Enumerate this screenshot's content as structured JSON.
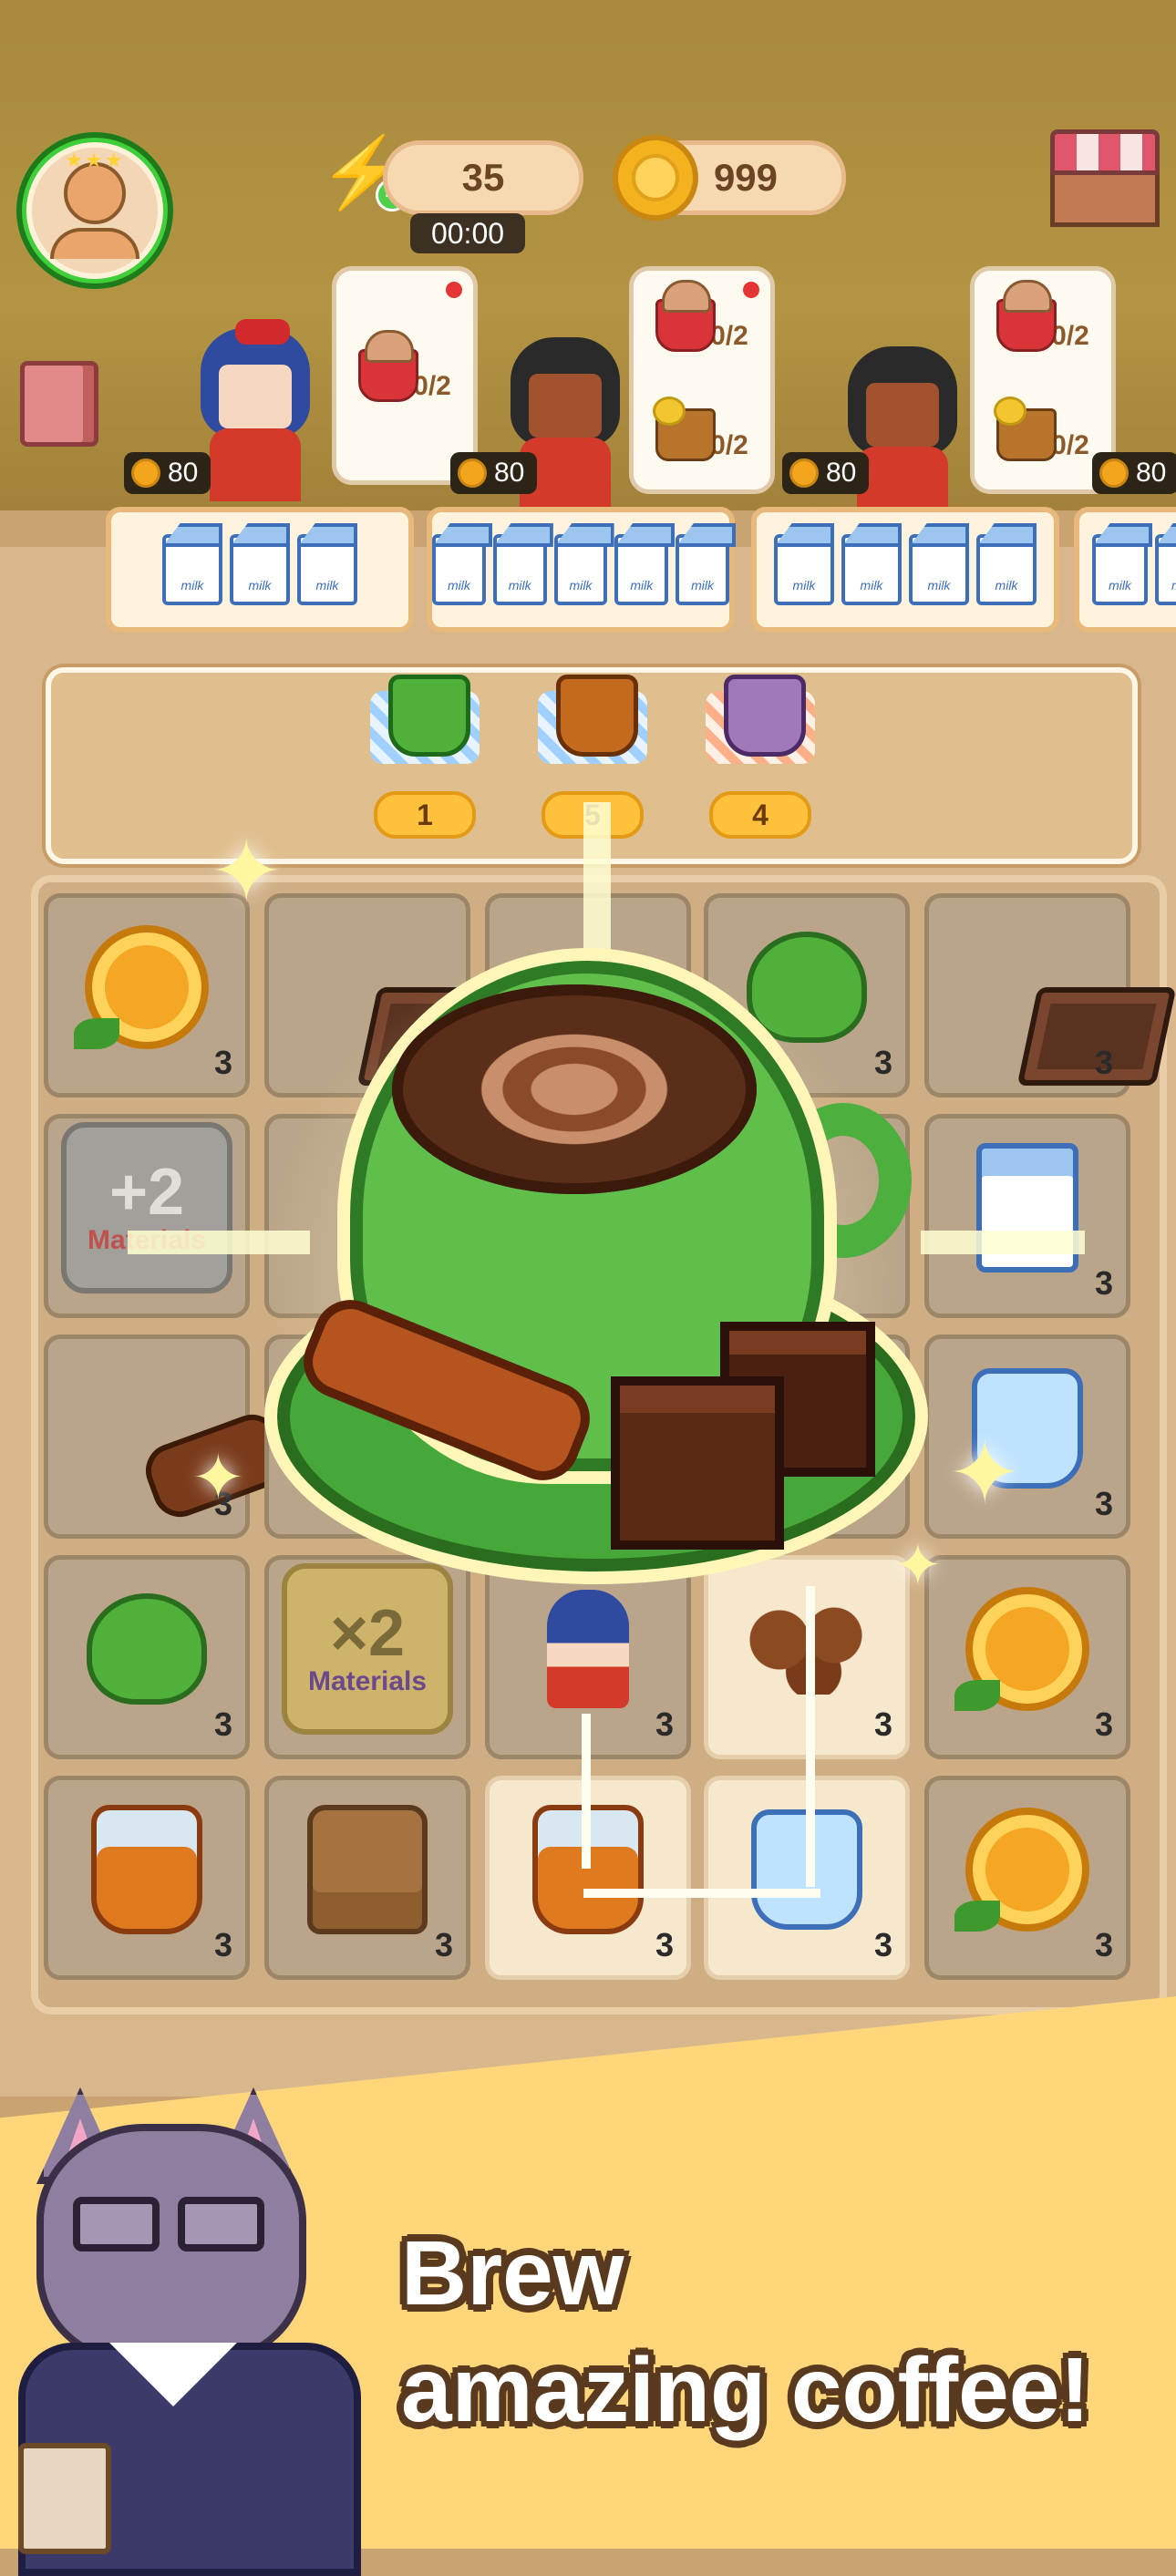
{
  "hud": {
    "energy": "35",
    "timer": "00:00",
    "gold": "999",
    "icons": [
      "profile-avatar",
      "energy-bolt-icon",
      "gold-coin-icon",
      "shop-stall-icon",
      "recipe-book-icon"
    ]
  },
  "customers": [
    {
      "reward": "80",
      "orders": [
        {
          "item": "red-latte",
          "count": "0/2"
        }
      ]
    },
    {
      "reward": "80",
      "orders": [
        {
          "item": "red-latte",
          "count": "0/2"
        },
        {
          "item": "orange-tea",
          "count": "0/2"
        }
      ]
    },
    {
      "reward": "80",
      "orders": [
        {
          "item": "red-latte",
          "count": "0/2"
        },
        {
          "item": "orange-tea",
          "count": "0/2"
        }
      ]
    },
    {
      "reward": "80"
    }
  ],
  "trays": [
    {
      "milk_count": 3,
      "milk_label": "milk"
    },
    {
      "milk_count": 5,
      "milk_label": "milk"
    },
    {
      "milk_count": 4,
      "milk_label": "milk"
    },
    {
      "milk_count": 2,
      "milk_label": "milk"
    }
  ],
  "recipes": [
    {
      "item": "green-tea-cup",
      "count": "1"
    },
    {
      "item": "orange-iced-tea",
      "count": "5"
    },
    {
      "item": "chocolate-latte",
      "count": "4"
    }
  ],
  "board": {
    "rows": [
      [
        {
          "item": "orange",
          "level": "3"
        },
        {
          "item": "chocolate",
          "level": ""
        },
        {
          "item": "",
          "level": ""
        },
        {
          "item": "mint",
          "level": "3"
        },
        {
          "item": "chocolate",
          "level": "3"
        }
      ],
      [
        {
          "item": "materials-x2-gray",
          "level": ""
        },
        {
          "item": "",
          "level": ""
        },
        {
          "item": "",
          "level": ""
        },
        {
          "item": "",
          "level": ""
        },
        {
          "item": "milk-carton",
          "level": "3"
        }
      ],
      [
        {
          "item": "cinnamon",
          "level": "3"
        },
        {
          "item": "",
          "level": ""
        },
        {
          "item": "",
          "level": ""
        },
        {
          "item": "",
          "level": ""
        },
        {
          "item": "water-jug",
          "level": "3"
        }
      ],
      [
        {
          "item": "mint",
          "level": "3"
        },
        {
          "item": "materials-x2",
          "level": ""
        },
        {
          "item": "barista-girl",
          "level": "3"
        },
        {
          "item": "coffee-beans",
          "level": "3"
        },
        {
          "item": "orange",
          "level": "3"
        }
      ],
      [
        {
          "item": "syrup-jar",
          "level": "3"
        },
        {
          "item": "tea-sack",
          "level": "3"
        },
        {
          "item": "syrup-jar",
          "level": "3"
        },
        {
          "item": "water-jug",
          "level": "3"
        },
        {
          "item": "orange",
          "level": "3"
        }
      ]
    ],
    "materials_x": "×2",
    "materials_label": "Materials",
    "materials_gray_x": "+2",
    "materials_gray_label": "Materials"
  },
  "featured": {
    "item": "cinnamon-chocolate-latte"
  },
  "banner": {
    "line1": "Brew",
    "line2": "amazing coffee!"
  },
  "colors": {
    "accent_green": "#47a83a",
    "gold": "#ffc23a",
    "banner": "#ffd67a"
  }
}
